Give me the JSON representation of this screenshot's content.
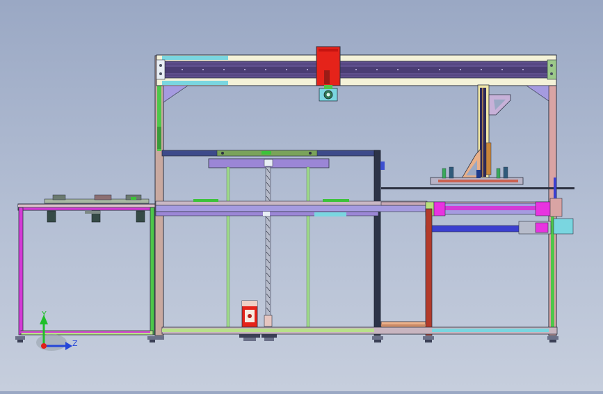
{
  "triad": {
    "y_label": "Y",
    "z_label": "Z",
    "y_color": "#1fbf2a",
    "z_color": "#2546d8",
    "origin_color": "#e0201a"
  },
  "palette": {
    "frame_outline": "#2c3140",
    "gantry_rail": "#5e4f8c",
    "gantry_top": "#f4f2d8",
    "carriage": "#e5231a",
    "magenta_frame": "#d43ad6",
    "green_frame": "#4ec74a",
    "cyan": "#7ad6e0",
    "plate_purple": "#9b86d6",
    "pink_post": "#d9a4a4",
    "dark_red": "#b33a2a",
    "blue_rail": "#3b3fcf"
  }
}
